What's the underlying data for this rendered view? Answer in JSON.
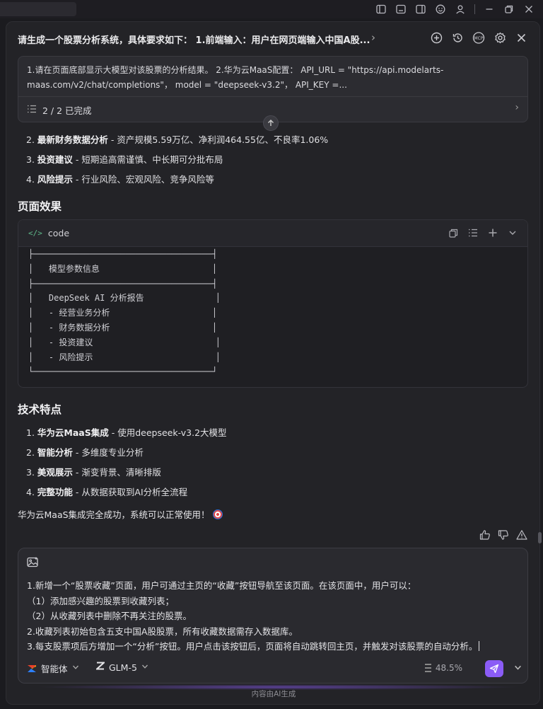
{
  "header": {
    "title": "请生成一个股票分析系统，具体要求如下： 1.前端输入：用户在网页端输入中国A股..."
  },
  "requirement": {
    "text_line1": "1.请在页面底部显示大模型对该股票的分析结果。 2.华为云MaaS配置： API_URL = \"https://api.modelarts-",
    "text_line2": "maas.com/v2/chat/completions\"， model = \"deepseek-v3.2\"， API_KEY =...",
    "progress": "2 / 2 已完成"
  },
  "list1": [
    {
      "num": "2.",
      "bold": "最新财务数据分析",
      "rest": " - 资产规模5.59万亿、净利润464.55亿、不良率1.06%"
    },
    {
      "num": "3.",
      "bold": "投资建议",
      "rest": " - 短期追高需谨慎、中长期可分批布局"
    },
    {
      "num": "4.",
      "bold": "风险提示",
      "rest": " - 行业风险、宏观风险、竞争风险等"
    }
  ],
  "section1_title": "页面效果",
  "codeblock": {
    "lang": "code",
    "content": "├───────────────────────────────────┤\n│   模型参数信息                      │\n├───────────────────────────────────┤\n│   DeepSeek AI 分析报告              │\n│   - 经营业务分析                    │\n│   - 财务数据分析                    │\n│   - 投资建议                        │\n│   - 风险提示                        │\n└───────────────────────────────────┘"
  },
  "section2_title": "技术特点",
  "list2": [
    {
      "num": "1.",
      "bold": "华为云MaaS集成",
      "rest": " - 使用deepseek-v3.2大模型"
    },
    {
      "num": "2.",
      "bold": "智能分析",
      "rest": " - 多维度专业分析"
    },
    {
      "num": "3.",
      "bold": "美观展示",
      "rest": " - 渐变背景、清晰排版"
    },
    {
      "num": "4.",
      "bold": "完整功能",
      "rest": " - 从数据获取到AI分析全流程"
    }
  ],
  "final_line": "华为云MaaS集成完全成功，系统可以正常使用！",
  "composer": {
    "lines": [
      "1.新增一个“股票收藏”页面，用户可通过主页的“收藏”按钮导航至该页面。在该页面中，用户可以：",
      "（1）添加感兴趣的股票到收藏列表；",
      "（2）从收藏列表中删除不再关注的股票。",
      "2.收藏列表初始包含五支中国A股股票，所有收藏数据需存入数据库。",
      "3.每支股票项后方增加一个“分析”按钮。用户点击该按钮后，页面将自动跳转回主页，并触发对该股票的自动分析。"
    ],
    "agent_label": "智能体",
    "model_label": "GLM-5",
    "context_usage": "48.5%"
  },
  "footer_note": "内容由AI生成",
  "colors": {
    "accent": "#8b5cf6",
    "background": "#1b1b1f",
    "panel": "#232327"
  }
}
